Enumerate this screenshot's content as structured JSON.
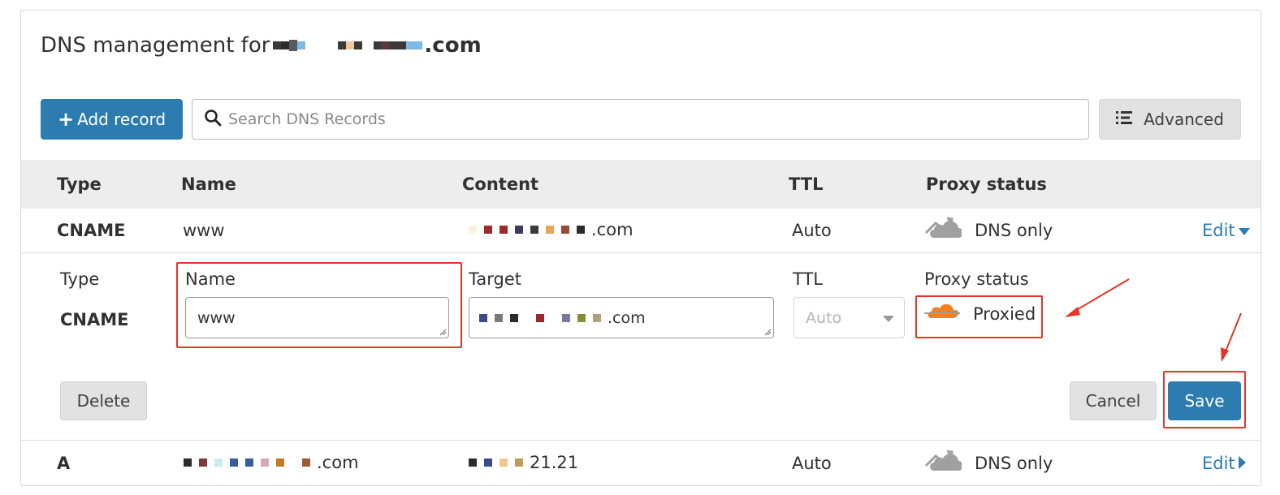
{
  "page": {
    "title_prefix": "DNS management for",
    "title_domain_visible": ".com"
  },
  "toolbar": {
    "add_label": "Add record",
    "search_placeholder": "Search DNS Records",
    "advanced_label": "Advanced"
  },
  "table": {
    "headers": {
      "type": "Type",
      "name": "Name",
      "content": "Content",
      "ttl": "TTL",
      "proxy": "Proxy status"
    }
  },
  "records": [
    {
      "type": "CNAME",
      "name": "www",
      "content_visible": ".com",
      "ttl": "Auto",
      "proxy": "DNS only",
      "action": "Edit"
    },
    {
      "type": "A",
      "name_visible": ".com",
      "content_visible": "21.21",
      "ttl": "Auto",
      "proxy": "DNS only",
      "action": "Edit"
    }
  ],
  "editor": {
    "type_label": "Type",
    "type_value": "CNAME",
    "name_label": "Name",
    "name_value": "www",
    "target_label": "Target",
    "target_value_visible": ".com",
    "ttl_label": "TTL",
    "ttl_value": "Auto",
    "proxy_label": "Proxy status",
    "proxy_value": "Proxied",
    "delete_label": "Delete",
    "cancel_label": "Cancel",
    "save_label": "Save"
  },
  "colors": {
    "accent": "#2c7cb0",
    "highlight": "#e5342a",
    "proxied_orange": "#f38020",
    "dns_only_gray": "#9e9e9e"
  },
  "icons": {
    "search": "search-icon",
    "advanced": "filter-list-icon",
    "dns_only": "gray-cloud-icon",
    "proxied": "orange-cloud-icon",
    "edit_open": "caret-down-icon",
    "edit_closed": "caret-right-icon"
  }
}
